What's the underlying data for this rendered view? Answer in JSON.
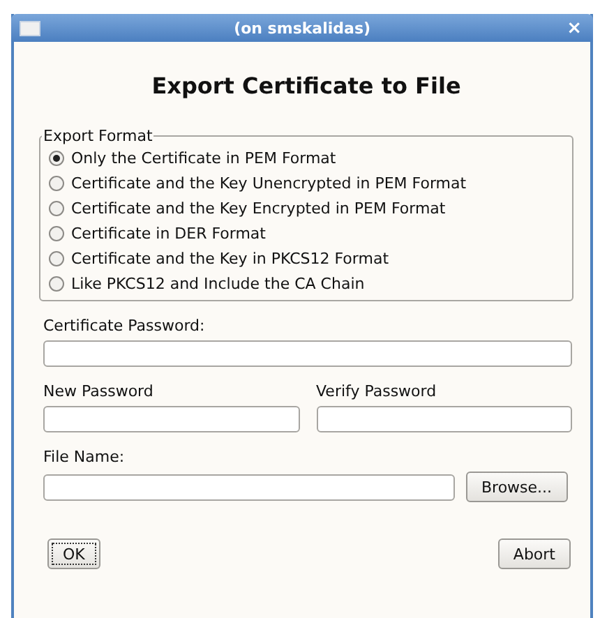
{
  "window": {
    "title": "(on smskalidas)",
    "close": "×"
  },
  "heading": "Export Certificate to File",
  "export_format": {
    "legend": "Export Format",
    "options": [
      {
        "label": "Only the Certificate in PEM Format",
        "selected": true
      },
      {
        "label": "Certificate and the Key Unencrypted in PEM Format",
        "selected": false
      },
      {
        "label": "Certificate and the Key Encrypted in PEM Format",
        "selected": false
      },
      {
        "label": "Certificate in DER Format",
        "selected": false
      },
      {
        "label": "Certificate and the Key in PKCS12 Format",
        "selected": false
      },
      {
        "label": "Like PKCS12 and Include the CA Chain",
        "selected": false
      }
    ]
  },
  "certificate_password": {
    "label": "Certificate Password:"
  },
  "new_password": {
    "label": "New Password"
  },
  "verify_password": {
    "label": "Verify Password"
  },
  "file_name": {
    "label": "File Name:",
    "browse": "Browse..."
  },
  "buttons": {
    "ok": "OK",
    "abort": "Abort"
  }
}
